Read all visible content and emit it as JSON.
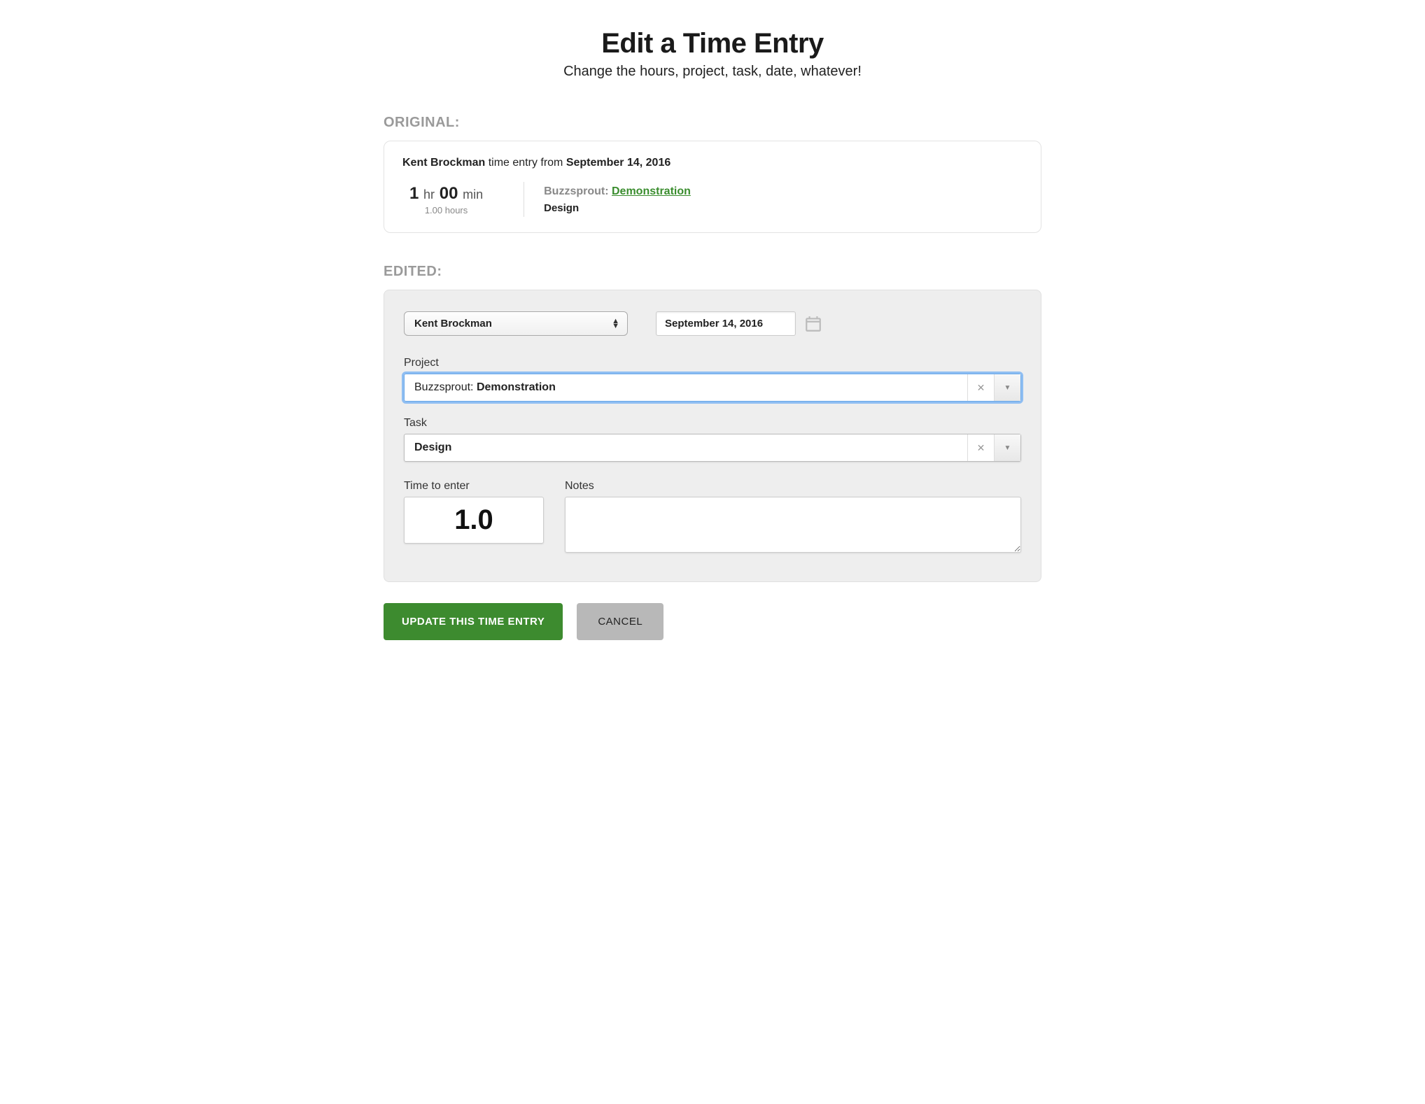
{
  "header": {
    "title": "Edit a Time Entry",
    "subtitle": "Change the hours, project, task, date, whatever!"
  },
  "sections": {
    "original_label": "ORIGINAL:",
    "edited_label": "EDITED:"
  },
  "original": {
    "person": "Kent Brockman",
    "mid_text": " time entry from ",
    "date": "September 14, 2016",
    "hr_num": "1",
    "hr_unit": "hr",
    "min_num": "00",
    "min_unit": "min",
    "decimal_hours": "1.00 hours",
    "client": "Buzzsprout:",
    "project": "Demonstration",
    "task": "Design"
  },
  "edited": {
    "person_selected": "Kent Brockman",
    "date_value": "September 14, 2016",
    "project_label": "Project",
    "project_prefix": "Buzzsprout: ",
    "project_value": "Demonstration",
    "task_label": "Task",
    "task_value": "Design",
    "time_label": "Time to enter",
    "time_value": "1.0",
    "notes_label": "Notes",
    "notes_value": ""
  },
  "actions": {
    "update": "UPDATE THIS TIME ENTRY",
    "cancel": "CANCEL"
  }
}
